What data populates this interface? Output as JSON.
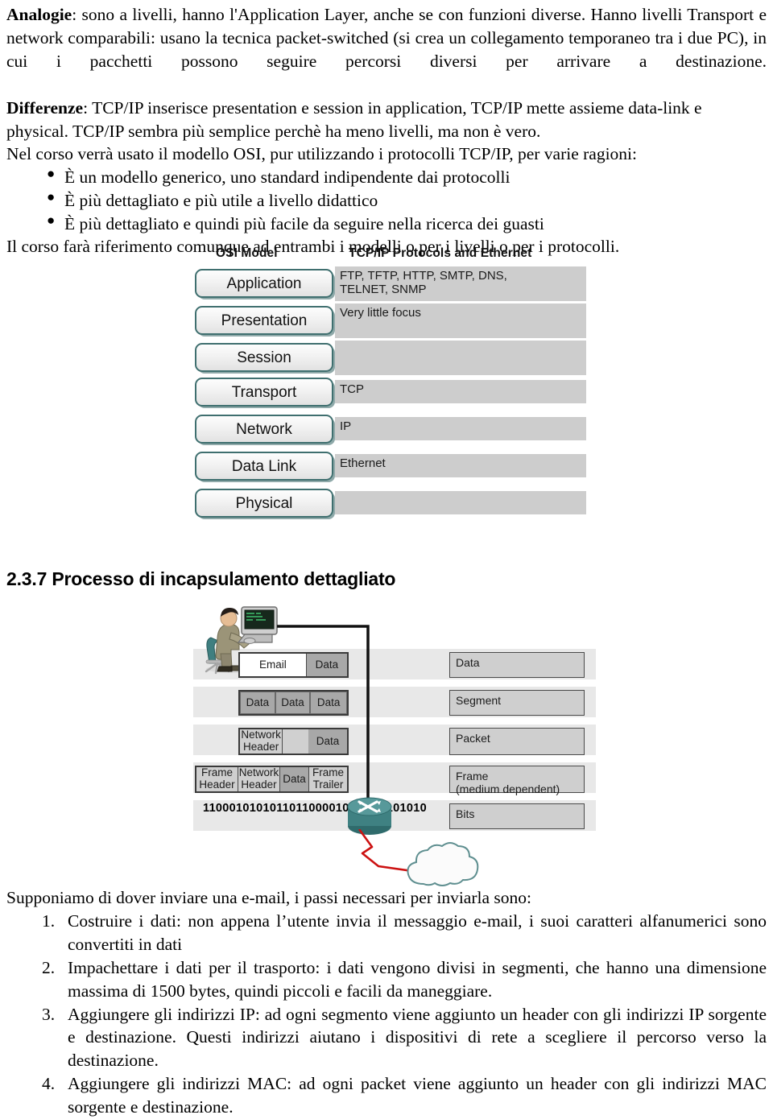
{
  "prose": {
    "p1_lead": "Analogie",
    "p1_rest": ": sono a livelli, hanno l'Application Layer, anche se con funzioni diverse. Hanno livelli Transport e network comparabili: usano la tecnica packet-switched (si crea un collegamento temporaneo tra i due PC), in cui i pacchetti possono seguire percorsi diversi per arrivare a destinazione.",
    "p2_lead": "Differenze",
    "p2_rest": ": TCP/IP inserisce presentation e session in application, TCP/IP mette assieme data-link e physical. TCP/IP sembra più semplice perchè ha meno livelli, ma non è vero.",
    "p3": "Nel corso verrà usato il modello OSI, pur utilizzando i protocolli TCP/IP, per varie ragioni:",
    "bullets": [
      "È un modello generico, uno standard indipendente dai protocolli",
      "È più dettagliato e più utile a livello didattico",
      "È più dettagliato e quindi più facile da seguire nella ricerca dei guasti"
    ],
    "bullet_glyph": "●",
    "p4": "Il corso farà riferimento comunque ad entrambi i modelli o per i livelli o per i protocolli."
  },
  "osi": {
    "heading_left": "OSI Model",
    "heading_right": "TCP/IP Protocols and Ethernet",
    "layers": [
      {
        "name": "Application",
        "protocols": "FTP, TFTP, HTTP, SMTP, DNS,\nTELNET, SNMP"
      },
      {
        "name": "Presentation",
        "protocols": "Very little focus"
      },
      {
        "name": "Session",
        "protocols": ""
      },
      {
        "name": "Transport",
        "protocols": "TCP"
      },
      {
        "name": "Network",
        "protocols": "IP"
      },
      {
        "name": "Data Link",
        "protocols": "Ethernet"
      },
      {
        "name": "Physical",
        "protocols": ""
      }
    ],
    "border_color": "#3f6f6f",
    "protocol_bg": "#cdcdcd"
  },
  "section": {
    "title": "2.3.7 Processo di incapsulamento dettagliato"
  },
  "encapsulation": {
    "rows": [
      {
        "pdu": "Data",
        "cells": [
          "Email",
          "Data"
        ]
      },
      {
        "pdu": "Segment",
        "cells": [
          "Data",
          "Data",
          "Data"
        ]
      },
      {
        "pdu": "Packet",
        "cells": [
          "Network\nHeader",
          "Data"
        ]
      },
      {
        "pdu": "Frame\n(medium dependent)",
        "cells": [
          "Frame\nHeader",
          "Network\nHeader",
          "Data",
          "Frame\nTrailer"
        ]
      },
      {
        "pdu": "Bits",
        "cells": []
      }
    ],
    "binary": "11000101010110110000101001 0101010",
    "icons": {
      "workstation": "person-at-computer-icon",
      "router": "router-icon",
      "cloud": "network-cloud-icon"
    },
    "link_color": "#cc1111",
    "router_color": "#3f7f7f"
  },
  "bottom": {
    "intro": "Supponiamo di dover inviare una e-mail, i passi necessari per inviarla sono:",
    "steps": [
      {
        "num": "1.",
        "text": "Costruire i dati: non appena l’utente invia il messaggio e-mail, i suoi caratteri alfanumerici sono convertiti in dati"
      },
      {
        "num": "2.",
        "text": "Impachettare i dati per il trasporto: i dati vengono divisi in segmenti, che hanno una dimensione massima di 1500 bytes, quindi piccoli e facili da maneggiare."
      },
      {
        "num": "3.",
        "text": "Aggiungere gli indirizzi IP: ad ogni segmento viene aggiunto un header con gli indirizzi IP sorgente e destinazione. Questi indirizzi aiutano i dispositivi di rete a scegliere il percorso verso la destinazione."
      },
      {
        "num": "4.",
        "text": "Aggiungere gli indirizzi MAC: ad ogni packet viene aggiunto un header con gli indirizzi MAC sorgente e destinazione."
      }
    ]
  }
}
